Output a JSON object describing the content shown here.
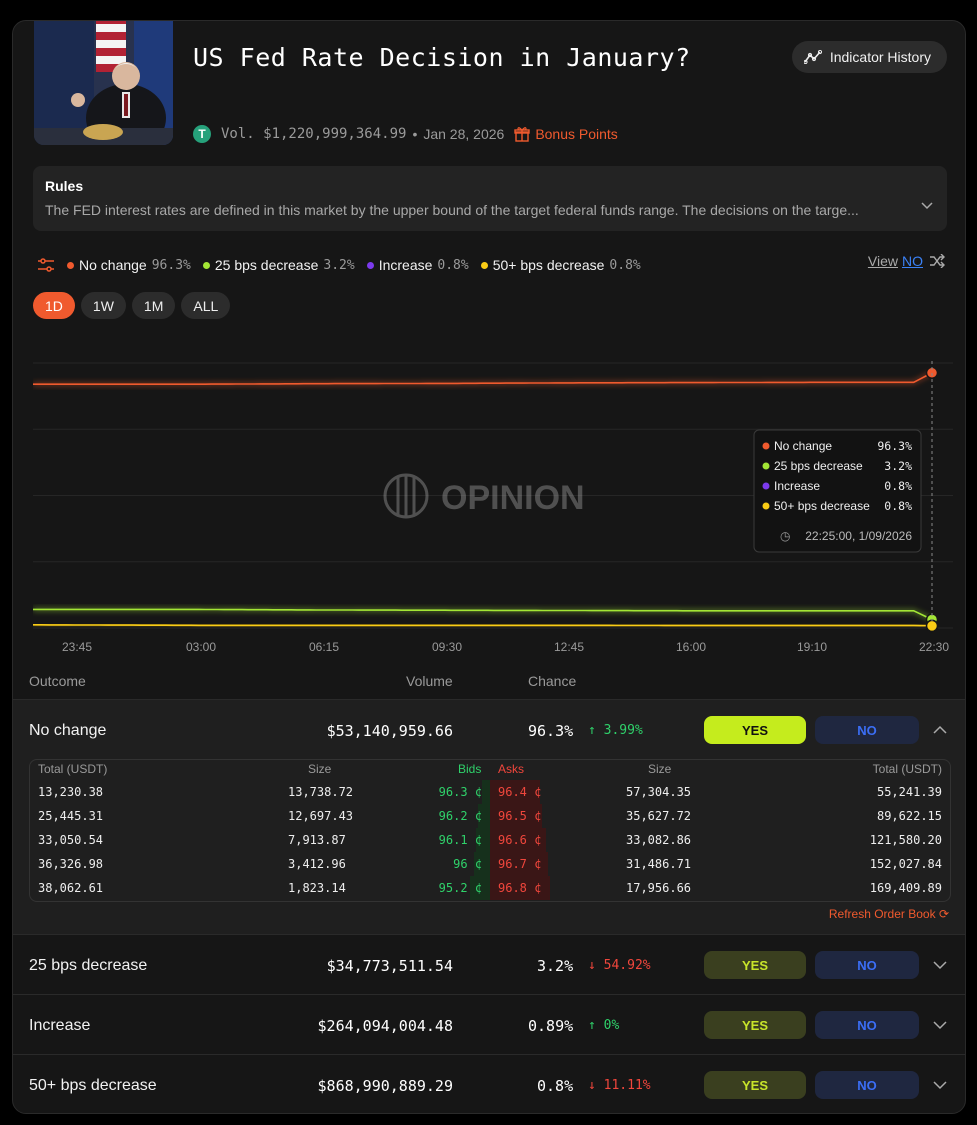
{
  "header": {
    "title": "US Fed Rate Decision in January?",
    "history_button": "Indicator History",
    "volume": "Vol. $1,220,999,364.99",
    "separator": "•",
    "date": "Jan 28, 2026",
    "bonus": "Bonus Points"
  },
  "rules": {
    "heading": "Rules",
    "text": "The FED interest rates are defined in this market by the upper bound of the target federal funds range. The decisions on the targe..."
  },
  "legend": [
    {
      "label": "No change",
      "pct": "96.3%",
      "color": "#f05a2e"
    },
    {
      "label": "25 bps decrease",
      "pct": "3.2%",
      "color": "#a3e635"
    },
    {
      "label": "Increase",
      "pct": "0.8%",
      "color": "#7c3aed"
    },
    {
      "label": "50+ bps decrease",
      "pct": "0.8%",
      "color": "#facc15"
    }
  ],
  "view_no": {
    "prefix": "View",
    "no": "NO"
  },
  "ranges": [
    "1D",
    "1W",
    "1M",
    "ALL"
  ],
  "active_range": "1D",
  "watermark": "OPINION",
  "tooltip": {
    "rows": [
      {
        "label": "No change",
        "value": "96.3%",
        "color": "#f05a2e"
      },
      {
        "label": "25 bps decrease",
        "value": "3.2%",
        "color": "#a3e635"
      },
      {
        "label": "Increase",
        "value": "0.8%",
        "color": "#7c3aed"
      },
      {
        "label": "50+ bps decrease",
        "value": "0.8%",
        "color": "#facc15"
      }
    ],
    "time": "22:25:00, 1/09/2026"
  },
  "chart_data": {
    "type": "line",
    "x": [
      "23:45",
      "03:00",
      "06:15",
      "09:30",
      "12:45",
      "16:00",
      "19:10",
      "22:30"
    ],
    "ylim": [
      0,
      100
    ],
    "series": [
      {
        "name": "No change",
        "color": "#f05a2e",
        "values": [
          92.0,
          92.0,
          92.2,
          92.3,
          92.5,
          92.6,
          92.7,
          96.3
        ]
      },
      {
        "name": "25 bps decrease",
        "color": "#a3e635",
        "values": [
          7.0,
          7.0,
          6.8,
          6.7,
          6.6,
          6.5,
          6.5,
          3.2
        ]
      },
      {
        "name": "Increase",
        "color": "#7c3aed",
        "values": [
          0.8,
          0.8,
          0.8,
          0.8,
          0.8,
          0.8,
          0.8,
          0.8
        ]
      },
      {
        "name": "50+ bps decrease",
        "color": "#facc15",
        "values": [
          1.2,
          1.0,
          1.0,
          1.0,
          1.0,
          0.9,
          0.9,
          0.8
        ]
      }
    ]
  },
  "table": {
    "headers": {
      "outcome": "Outcome",
      "volume": "Volume",
      "chance": "Chance"
    },
    "rows": [
      {
        "name": "No change",
        "volume": "$53,140,959.66",
        "chance": "96.3%",
        "delta": "↑ 3.99%",
        "dir": "up",
        "expanded": true
      },
      {
        "name": "25 bps decrease",
        "volume": "$34,773,511.54",
        "chance": "3.2%",
        "delta": "↓ 54.92%",
        "dir": "down",
        "expanded": false
      },
      {
        "name": "Increase",
        "volume": "$264,094,004.48",
        "chance": "0.89%",
        "delta": "↑ 0%",
        "dir": "up",
        "expanded": false
      },
      {
        "name": "50+ bps decrease",
        "volume": "$868,990,889.29",
        "chance": "0.8%",
        "delta": "↓ 11.11%",
        "dir": "down",
        "expanded": false
      }
    ],
    "yes_label": "YES",
    "no_label": "NO"
  },
  "orderbook": {
    "headers": {
      "total_left": "Total (USDT)",
      "size_left": "Size",
      "bids": "Bids",
      "asks": "Asks",
      "size_right": "Size",
      "total_right": "Total (USDT)"
    },
    "rows": [
      {
        "total_bid": "13,230.38",
        "size_bid": "13,738.72",
        "bid": "96.3 ¢",
        "ask": "96.4 ¢",
        "size_ask": "57,304.35",
        "total_ask": "55,241.39"
      },
      {
        "total_bid": "25,445.31",
        "size_bid": "12,697.43",
        "bid": "96.2 ¢",
        "ask": "96.5 ¢",
        "size_ask": "35,627.72",
        "total_ask": "89,622.15"
      },
      {
        "total_bid": "33,050.54",
        "size_bid": "7,913.87",
        "bid": "96.1 ¢",
        "ask": "96.6 ¢",
        "size_ask": "33,082.86",
        "total_ask": "121,580.20"
      },
      {
        "total_bid": "36,326.98",
        "size_bid": "3,412.96",
        "bid": "96 ¢",
        "ask": "96.7 ¢",
        "size_ask": "31,486.71",
        "total_ask": "152,027.84"
      },
      {
        "total_bid": "38,062.61",
        "size_bid": "1,823.14",
        "bid": "95.2 ¢",
        "ask": "96.8 ¢",
        "size_ask": "17,956.66",
        "total_ask": "169,409.89"
      }
    ],
    "refresh": "Refresh Order Book"
  }
}
